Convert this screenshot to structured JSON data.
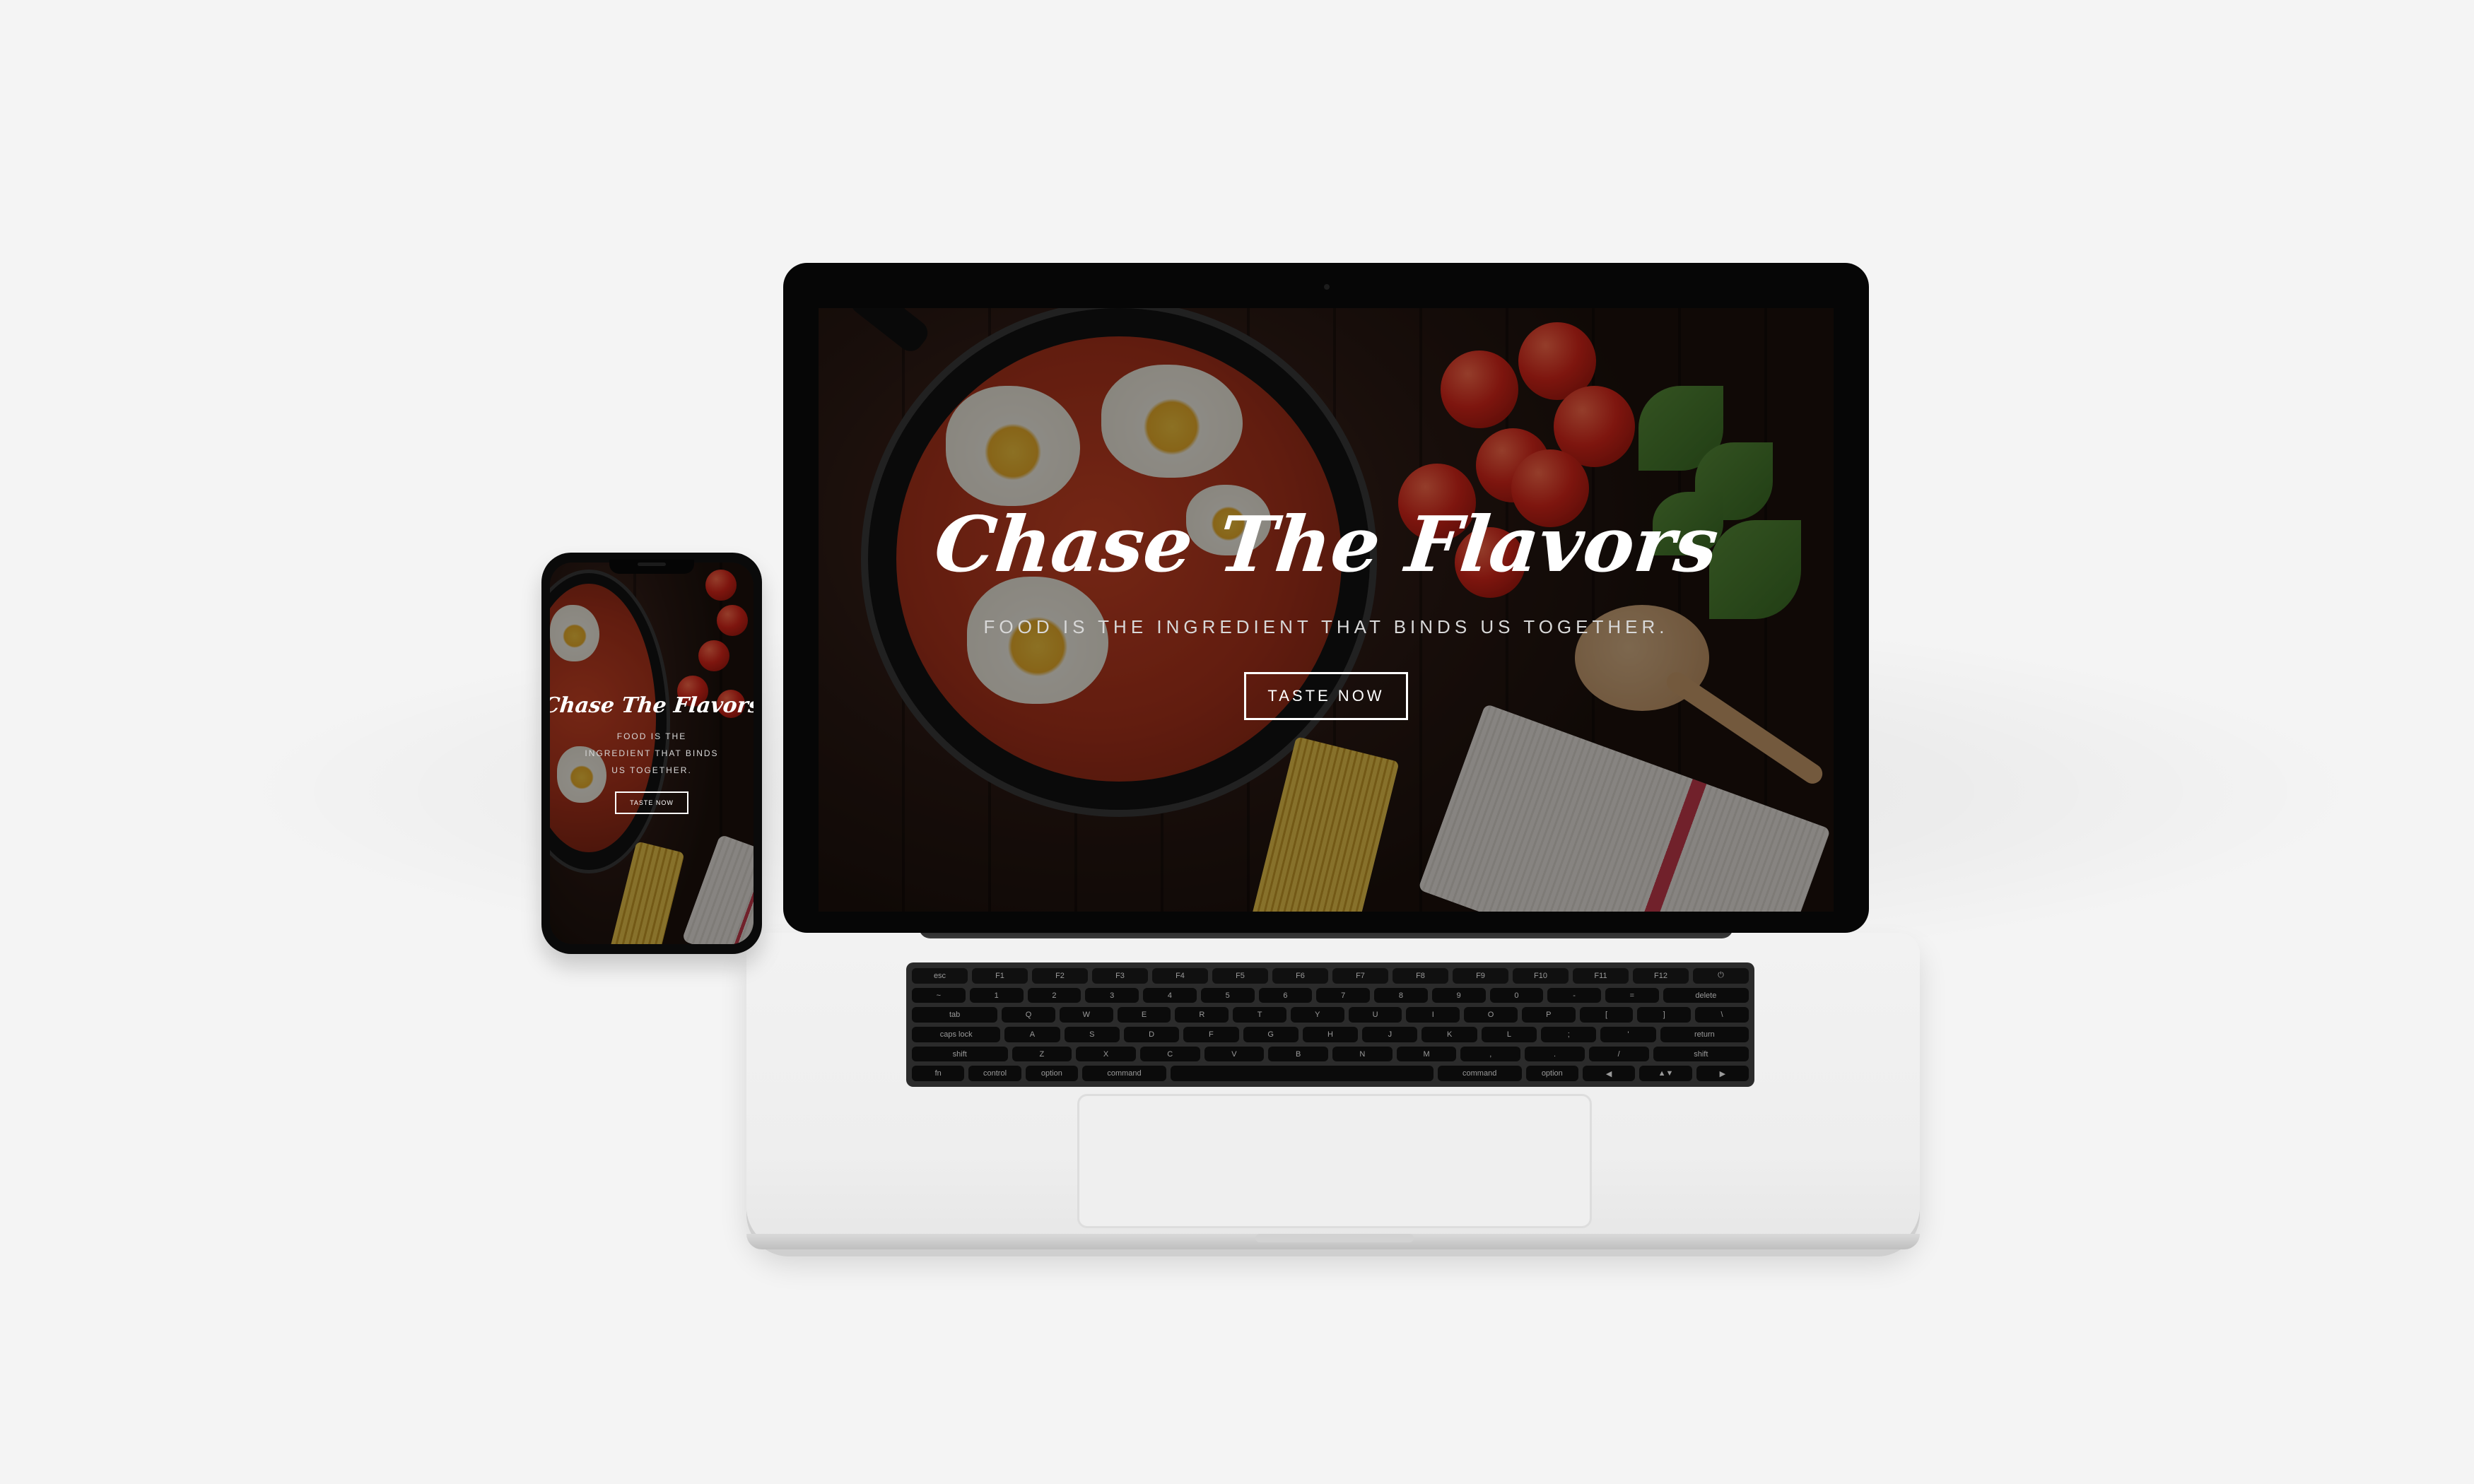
{
  "hero": {
    "title": "Chase The Flavors",
    "tagline": "Food is the ingredient that binds us together.",
    "button_label": "Taste Now"
  },
  "phone_hero": {
    "title": "Chase The Flavors",
    "tagline": "Food is the ingredient that binds us together.",
    "button_label": "Taste Now"
  },
  "keyboard": {
    "rows": [
      [
        "esc",
        "F1",
        "F2",
        "F3",
        "F4",
        "F5",
        "F6",
        "F7",
        "F8",
        "F9",
        "F10",
        "F11",
        "F12",
        "⏻"
      ],
      [
        "~",
        "1",
        "2",
        "3",
        "4",
        "5",
        "6",
        "7",
        "8",
        "9",
        "0",
        "-",
        "=",
        "delete"
      ],
      [
        "tab",
        "Q",
        "W",
        "E",
        "R",
        "T",
        "Y",
        "U",
        "I",
        "O",
        "P",
        "[",
        "]",
        "\\"
      ],
      [
        "caps lock",
        "A",
        "S",
        "D",
        "F",
        "G",
        "H",
        "J",
        "K",
        "L",
        ";",
        "'",
        "return"
      ],
      [
        "shift",
        "Z",
        "X",
        "C",
        "V",
        "B",
        "N",
        "M",
        ",",
        ".",
        "/",
        "shift"
      ],
      [
        "fn",
        "control",
        "option",
        "command",
        "",
        "command",
        "option",
        "◀",
        "▲▼",
        "▶"
      ]
    ]
  },
  "colors": {
    "background": "#f4f4f4",
    "device_bezel": "#060606",
    "laptop_body": "#eeeeee",
    "hero_text": "#ffffff",
    "accent_towel": "#c33a4a"
  }
}
